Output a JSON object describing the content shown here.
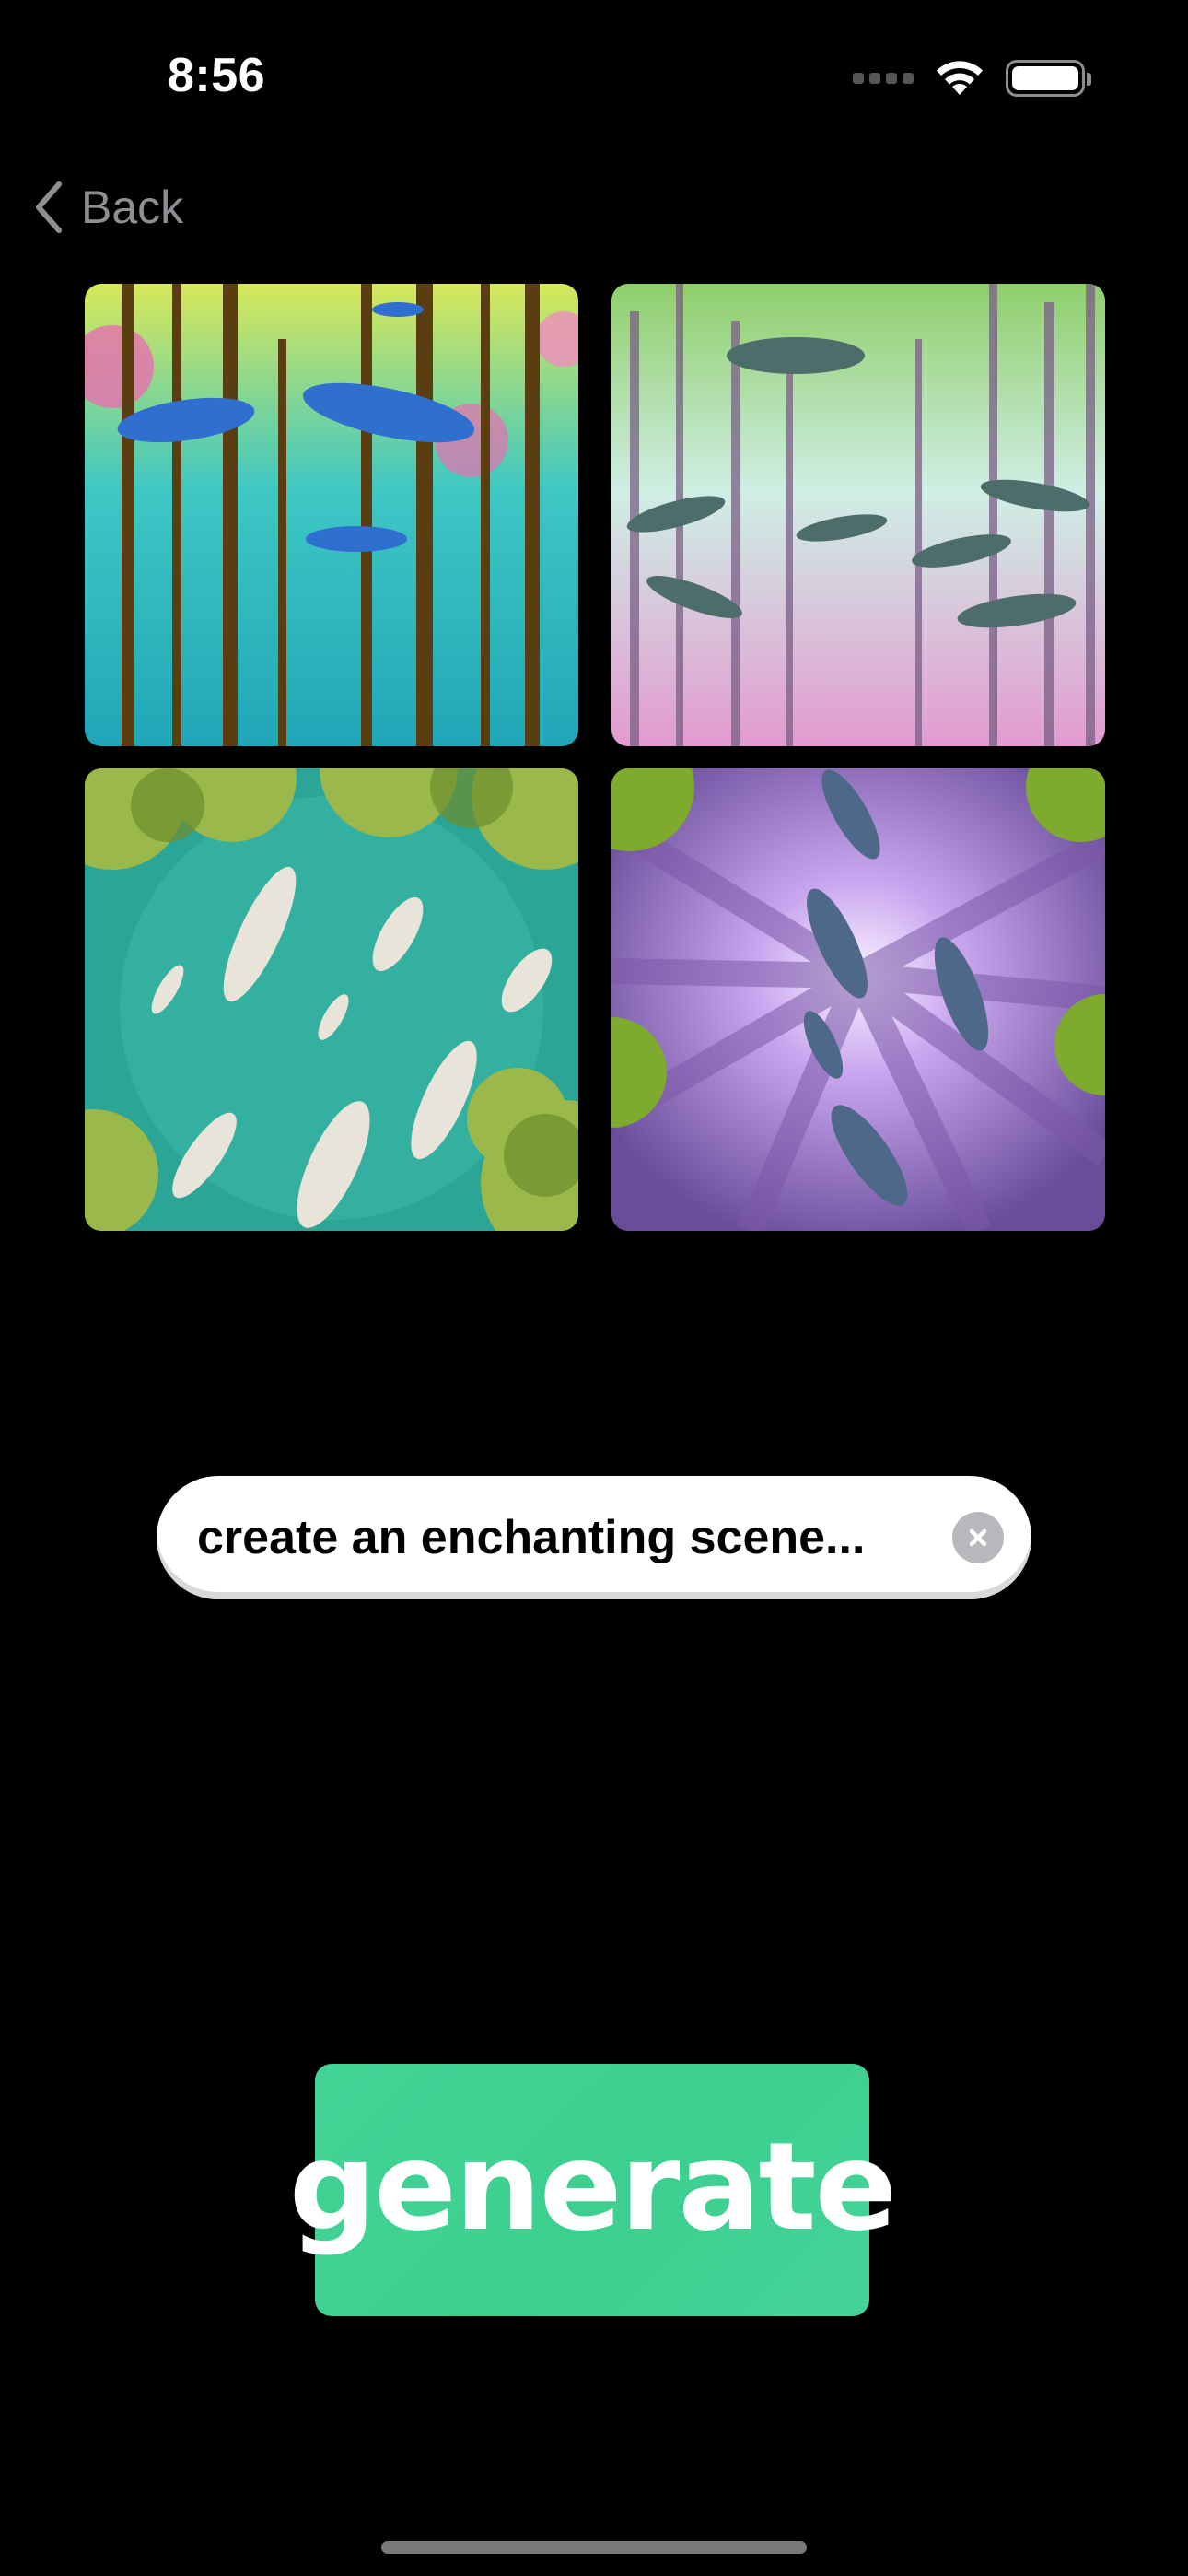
{
  "status_bar": {
    "time": "8:56",
    "icons": [
      "cellular-icon",
      "wifi-icon",
      "battery-icon"
    ]
  },
  "nav": {
    "back_label": "Back",
    "back_icon": "chevron-left-icon"
  },
  "images": [
    {
      "name": "generated-image-1",
      "palette": [
        "#2bc2c7",
        "#e86fb0",
        "#2a5fb0"
      ]
    },
    {
      "name": "generated-image-2",
      "palette": [
        "#b9e6d3",
        "#e7a6d7",
        "#4d6d6a"
      ]
    },
    {
      "name": "generated-image-3",
      "palette": [
        "#2aa596",
        "#9bb84a",
        "#e9e4d9"
      ]
    },
    {
      "name": "generated-image-4",
      "palette": [
        "#a87bd0",
        "#f3e8ff",
        "#4d6889"
      ]
    }
  ],
  "prompt": {
    "value": "create an enchanting scene...",
    "clear_icon": "clear-icon"
  },
  "generate_label": "generate",
  "colors": {
    "background": "#000000",
    "accent": "#3ccf8e",
    "secondary_text": "#8e8e93"
  }
}
